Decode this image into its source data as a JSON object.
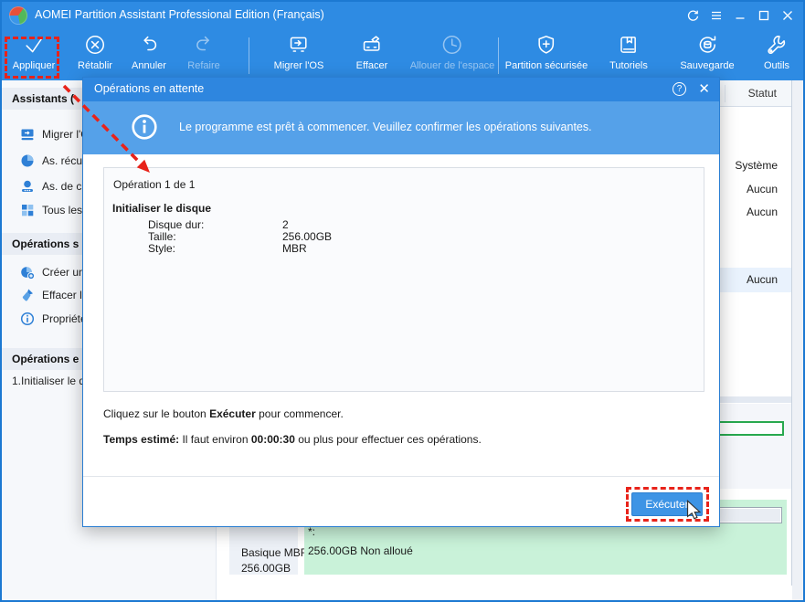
{
  "titlebar": {
    "title": "AOMEI Partition Assistant Professional Edition (Français)"
  },
  "toolbar": {
    "items": [
      {
        "label": "Appliquer",
        "icon": "apply-check-icon",
        "enabled": true,
        "highlighted": true
      },
      {
        "label": "Rétablir",
        "icon": "discard-icon",
        "enabled": true
      },
      {
        "label": "Annuler",
        "icon": "undo-icon",
        "enabled": true
      },
      {
        "label": "Refaire",
        "icon": "redo-icon",
        "enabled": false
      },
      {
        "label": "Migrer l'OS",
        "icon": "migrate-os-icon",
        "enabled": true
      },
      {
        "label": "Effacer",
        "icon": "wipe-disk-icon",
        "enabled": true
      },
      {
        "label": "Allouer de l'espace",
        "icon": "allocate-space-icon",
        "enabled": false
      },
      {
        "label": "Partition sécurisée",
        "icon": "secure-partition-icon",
        "enabled": true
      },
      {
        "label": "Tutoriels",
        "icon": "tutorials-icon",
        "enabled": true
      },
      {
        "label": "Sauvegarde",
        "icon": "backup-icon",
        "enabled": true
      },
      {
        "label": "Outils",
        "icon": "tools-icon",
        "enabled": true
      }
    ]
  },
  "sidebar": {
    "sections": [
      {
        "title": "Assistants (",
        "items": [
          {
            "label": "Migrer l'O",
            "icon": "migrate-os-icon"
          },
          {
            "label": "As. récu",
            "icon": "recovery-wizard-icon"
          },
          {
            "label": "As. de c",
            "icon": "creation-wizard-icon"
          },
          {
            "label": "Tous les",
            "icon": "all-tools-icon"
          }
        ]
      },
      {
        "title": "Opérations s",
        "items": [
          {
            "label": "Créer un",
            "icon": "create-partition-icon"
          },
          {
            "label": "Effacer l",
            "icon": "wipe-icon"
          },
          {
            "label": "Propriéte",
            "icon": "properties-icon"
          }
        ]
      },
      {
        "title": "Opérations e",
        "items": [
          {
            "label": "1.Initialiser le d",
            "icon": null
          }
        ]
      }
    ]
  },
  "status_panel": {
    "column_header": "Statut",
    "rows": [
      "Système",
      "Aucun",
      "Aucun"
    ],
    "selected_row": "Aucun"
  },
  "disk_map": {
    "disk2": {
      "label_line1": "Basique MBR",
      "label_line2": "256.00GB",
      "partition_name": "*:",
      "partition_info": "256.00GB Non alloué"
    }
  },
  "dialog": {
    "title": "Opérations en attente",
    "banner_message": "Le programme est prêt à commencer. Veuillez confirmer les opérations suivantes.",
    "operation_counter": "Opération 1 de 1",
    "operation_name": "Initialiser le disque",
    "details": [
      {
        "label": "Disque dur:",
        "value": "2"
      },
      {
        "label": "Taille:",
        "value": "256.00GB"
      },
      {
        "label": "Style:",
        "value": "MBR"
      }
    ],
    "instruction": {
      "pre": "Cliquez sur le bouton ",
      "bold": "Exécuter",
      "post": " pour commencer."
    },
    "estimate": {
      "bold_label": "Temps estimé:",
      "pre": " Il faut environ ",
      "bold_time": "00:00:30",
      "post": " ou plus pour effectuer ces opérations."
    },
    "execute_button": "Exécuter"
  },
  "colors": {
    "titlebar_blue": "#2E8BE3",
    "dialog_header_blue": "#2E86DF",
    "banner_blue": "#55A1E9",
    "button_blue": "#3E94E5",
    "annotation_red": "#E8231A",
    "partition_green_fill": "#C9F2D9",
    "partition_green_border": "#28A84E",
    "selected_row_blue": "#E9F2FD"
  }
}
